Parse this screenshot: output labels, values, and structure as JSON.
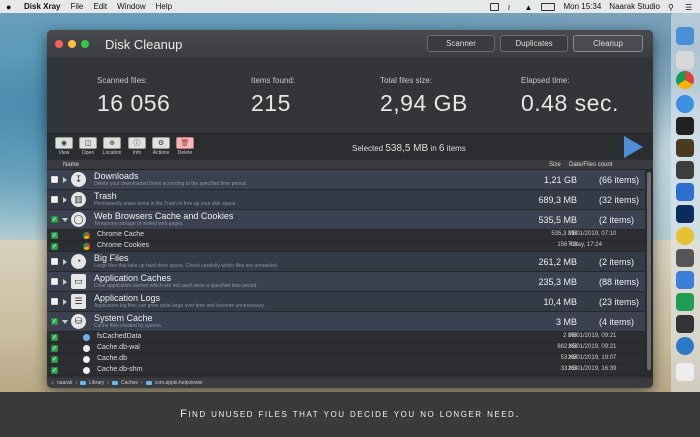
{
  "menubar": {
    "app_name": "Disk Xray",
    "items": [
      "File",
      "Edit",
      "Window",
      "Help"
    ],
    "clock": "Mon 15:34",
    "user": "Naarak Studio"
  },
  "window": {
    "title": "Disk Cleanup",
    "tabs": [
      {
        "label": "Scanner",
        "active": false
      },
      {
        "label": "Duplicates",
        "active": false
      },
      {
        "label": "Cleanup",
        "active": true
      }
    ]
  },
  "stats": {
    "scanned_label": "Scanned files:",
    "scanned_value": "16 056",
    "found_label": "Items found:",
    "found_value": "215",
    "size_label": "Total files size:",
    "size_value": "2,94 GB",
    "elapsed_label": "Elapsed time:",
    "elapsed_value": "0.48 sec."
  },
  "toolbar": {
    "buttons": [
      "View",
      "Open",
      "Location",
      "Info",
      "Actions",
      "Delete"
    ],
    "selected_prefix": "Selected",
    "selected_size": "538,5 MB",
    "selected_mid": "in",
    "selected_count": "6",
    "selected_suffix": "items"
  },
  "columns": {
    "name": "Name",
    "size": "Size",
    "date": "Date/Files count"
  },
  "rows": [
    {
      "checked": false,
      "name": "Downloads",
      "desc": "Delete your downloaded items according to the specified time period.",
      "size": "1,21 GB",
      "count": "(66 items)"
    },
    {
      "checked": false,
      "name": "Trash",
      "desc": "Permanently erase items in the Trash to free up your disk space.",
      "size": "689,3 MB",
      "count": "(32 items)"
    },
    {
      "checked": true,
      "name": "Web Browsers Cache and Cookies",
      "desc": "Temporary storage of visited web pages.",
      "size": "535,5 MB",
      "count": "(2 items)"
    },
    {
      "checked": false,
      "name": "Big Files",
      "desc": "Large files that take up hard drive space. Check carefully which files are unneeded.",
      "size": "261,2 MB",
      "count": "(2 items)"
    },
    {
      "checked": false,
      "name": "Application Caches",
      "desc": "Clear application caches which are not used since a specified time period.",
      "size": "235,3 MB",
      "count": "(88 items)"
    },
    {
      "checked": false,
      "name": "Application Logs",
      "desc": "Application log files can grow quite large over time and become unnecessary.",
      "size": "10,4 MB",
      "count": "(23 items)"
    },
    {
      "checked": true,
      "name": "System Cache",
      "desc": "Cache files created by system.",
      "size": "3 MB",
      "count": "(4 items)"
    }
  ],
  "browser_items": [
    {
      "name": "Chrome Cache",
      "size": "535,3 MB",
      "date": "31/01/2019, 07:10"
    },
    {
      "name": "Chrome Cookies",
      "size": "156 KB",
      "date": "Today, 17:24"
    }
  ],
  "system_items": [
    {
      "name": "fsCachedData",
      "size": "2 MB",
      "date": "26/01/2019, 09:21"
    },
    {
      "name": "Cache.db-wal",
      "size": "882 KB",
      "date": "26/01/2019, 09:21"
    },
    {
      "name": "Cache.db",
      "size": "53 KB",
      "date": "26/01/2019, 19:07"
    },
    {
      "name": "Cache.db-shm",
      "size": "33 KB",
      "date": "26/01/2019, 16:39"
    }
  ],
  "pathbar": [
    "naarak",
    "Library",
    "Caches",
    "com.apple.helpviewer"
  ],
  "caption": "Find unused files that you decide you no longer need."
}
